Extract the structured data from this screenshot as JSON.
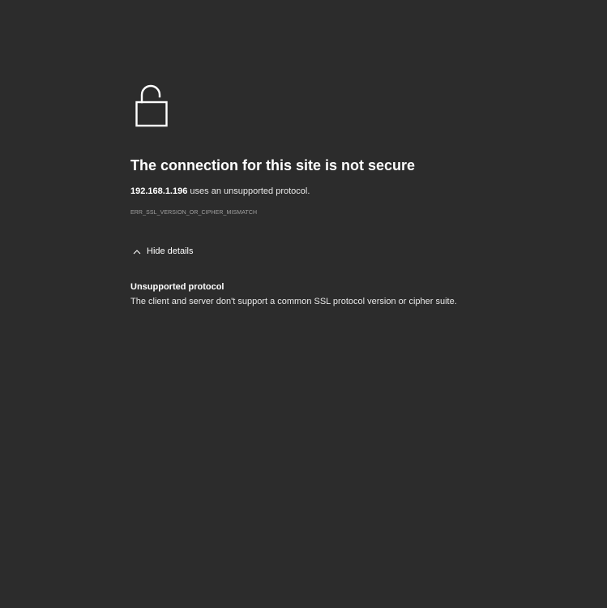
{
  "colors": {
    "background": "#2c2c2c",
    "text": "#ffffff",
    "muted_text": "#a0a0a0"
  },
  "icon": {
    "name": "unlocked-padlock-icon"
  },
  "error": {
    "title": "The connection for this site is not secure",
    "host": "192.168.1.196",
    "host_suffix": " uses an unsupported protocol.",
    "code": "ERR_SSL_VERSION_OR_CIPHER_MISMATCH"
  },
  "details_toggle": {
    "icon": "chevron-up-icon",
    "label": "Hide details"
  },
  "details": {
    "heading": "Unsupported protocol",
    "text": "The client and server don't support a common SSL protocol version or cipher suite."
  }
}
